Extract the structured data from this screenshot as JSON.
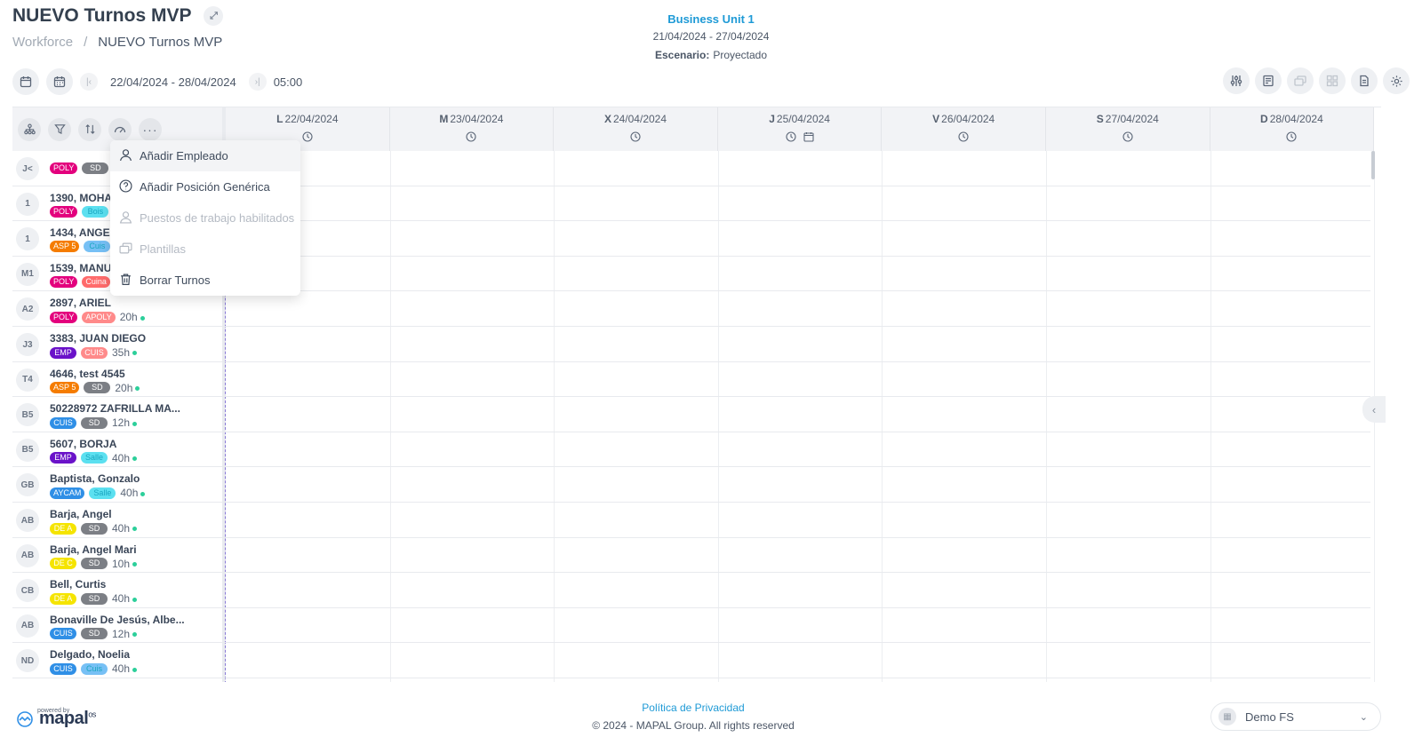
{
  "header": {
    "title": "NUEVO Turnos MVP",
    "breadcrumb": [
      "Workforce",
      "NUEVO Turnos MVP"
    ],
    "business_unit": "Business Unit 1",
    "unit_dates": "21/04/2024 - 27/04/2024",
    "escenario_label": "Escenario:",
    "escenario_value": "Proyectado"
  },
  "toolbar": {
    "range": "22/04/2024 - 28/04/2024",
    "time": "05:00"
  },
  "days": [
    {
      "letter": "L",
      "date": "22/04/2024"
    },
    {
      "letter": "M",
      "date": "23/04/2024"
    },
    {
      "letter": "X",
      "date": "24/04/2024"
    },
    {
      "letter": "J",
      "date": "25/04/2024",
      "extra_icon": "calendar-clock-icon"
    },
    {
      "letter": "V",
      "date": "26/04/2024"
    },
    {
      "letter": "S",
      "date": "27/04/2024"
    },
    {
      "letter": "D",
      "date": "28/04/2024"
    }
  ],
  "employees": [
    {
      "initials": "J<",
      "name": "",
      "tags": [
        {
          "t": "POLY",
          "c": "#e3007d"
        },
        {
          "t": "SD",
          "c": "#7c7f85"
        }
      ],
      "hours": ""
    },
    {
      "initials": "1",
      "name": "1390, MOHAI",
      "tags": [
        {
          "t": "POLY",
          "c": "#e3007d"
        },
        {
          "t": "Bois",
          "c": "#5ce0f0"
        }
      ],
      "hours": ""
    },
    {
      "initials": "1",
      "name": "1434, ANGEL",
      "tags": [
        {
          "t": "ASP 5",
          "c": "#f57c00"
        },
        {
          "t": "Cuis",
          "c": "#77c0f5"
        }
      ],
      "hours": ""
    },
    {
      "initials": "M1",
      "name": "1539, MANUE",
      "tags": [
        {
          "t": "POLY",
          "c": "#e3007d"
        },
        {
          "t": "Cuina",
          "c": "#ff6b6b"
        }
      ],
      "hours": ""
    },
    {
      "initials": "A2",
      "name": "2897, ARIEL",
      "tags": [
        {
          "t": "POLY",
          "c": "#e3007d"
        },
        {
          "t": "APOLY",
          "c": "#ff8a8a"
        }
      ],
      "hours": "20h"
    },
    {
      "initials": "J3",
      "name": "3383, JUAN DIEGO",
      "tags": [
        {
          "t": "EMP",
          "c": "#6a12c9"
        },
        {
          "t": "CUIS",
          "c": "#ff8a8a"
        }
      ],
      "hours": "35h"
    },
    {
      "initials": "T4",
      "name": "4646, test 4545",
      "tags": [
        {
          "t": "ASP 5",
          "c": "#f57c00"
        },
        {
          "t": "SD",
          "c": "#7c7f85"
        }
      ],
      "hours": "20h"
    },
    {
      "initials": "B5",
      "name": "50228972 ZAFRILLA MA...",
      "tags": [
        {
          "t": "CUIS",
          "c": "#2f8fe6"
        },
        {
          "t": "SD",
          "c": "#7c7f85"
        }
      ],
      "hours": "12h"
    },
    {
      "initials": "B5",
      "name": "5607, BORJA",
      "tags": [
        {
          "t": "EMP",
          "c": "#6a12c9"
        },
        {
          "t": "Salle",
          "c": "#5ce0f0"
        }
      ],
      "hours": "40h"
    },
    {
      "initials": "GB",
      "name": "Baptista, Gonzalo",
      "tags": [
        {
          "t": "AYCAM",
          "c": "#2f8fe6"
        },
        {
          "t": "Salle",
          "c": "#5ce0f0"
        }
      ],
      "hours": "40h"
    },
    {
      "initials": "AB",
      "name": "Barja, Angel",
      "tags": [
        {
          "t": "DE A",
          "c": "#f5e400"
        },
        {
          "t": "SD",
          "c": "#7c7f85"
        }
      ],
      "hours": "40h"
    },
    {
      "initials": "AB",
      "name": "Barja, Angel Mari",
      "tags": [
        {
          "t": "DE C",
          "c": "#f5e400"
        },
        {
          "t": "SD",
          "c": "#7c7f85"
        }
      ],
      "hours": "10h"
    },
    {
      "initials": "CB",
      "name": "Bell, Curtis",
      "tags": [
        {
          "t": "DE A",
          "c": "#f5e400"
        },
        {
          "t": "SD",
          "c": "#7c7f85"
        }
      ],
      "hours": "40h"
    },
    {
      "initials": "AB",
      "name": "Bonaville De Jesús, Albe...",
      "tags": [
        {
          "t": "CUIS",
          "c": "#2f8fe6"
        },
        {
          "t": "SD",
          "c": "#7c7f85"
        }
      ],
      "hours": "12h"
    },
    {
      "initials": "ND",
      "name": "Delgado, Noelia",
      "tags": [
        {
          "t": "CUIS",
          "c": "#2f8fe6"
        },
        {
          "t": "Cuis",
          "c": "#77c0f5"
        }
      ],
      "hours": "40h"
    }
  ],
  "menu": [
    {
      "label": "Añadir Empleado",
      "icon": "user-icon",
      "enabled": true
    },
    {
      "label": "Añadir Posición Genérica",
      "icon": "question-circle-icon",
      "enabled": true
    },
    {
      "label": "Puestos de trabajo habilitados",
      "icon": "user-badge-icon",
      "enabled": false
    },
    {
      "label": "Plantillas",
      "icon": "templates-icon",
      "enabled": false
    },
    {
      "label": "Borrar Turnos",
      "icon": "trash-icon",
      "enabled": true
    }
  ],
  "footer": {
    "privacy": "Política de Privacidad",
    "copyright": "© 2024 - MAPAL Group. All rights reserved",
    "powered": "powered by",
    "logo": "mapal",
    "logo_sup": "os",
    "account": "Demo FS"
  }
}
